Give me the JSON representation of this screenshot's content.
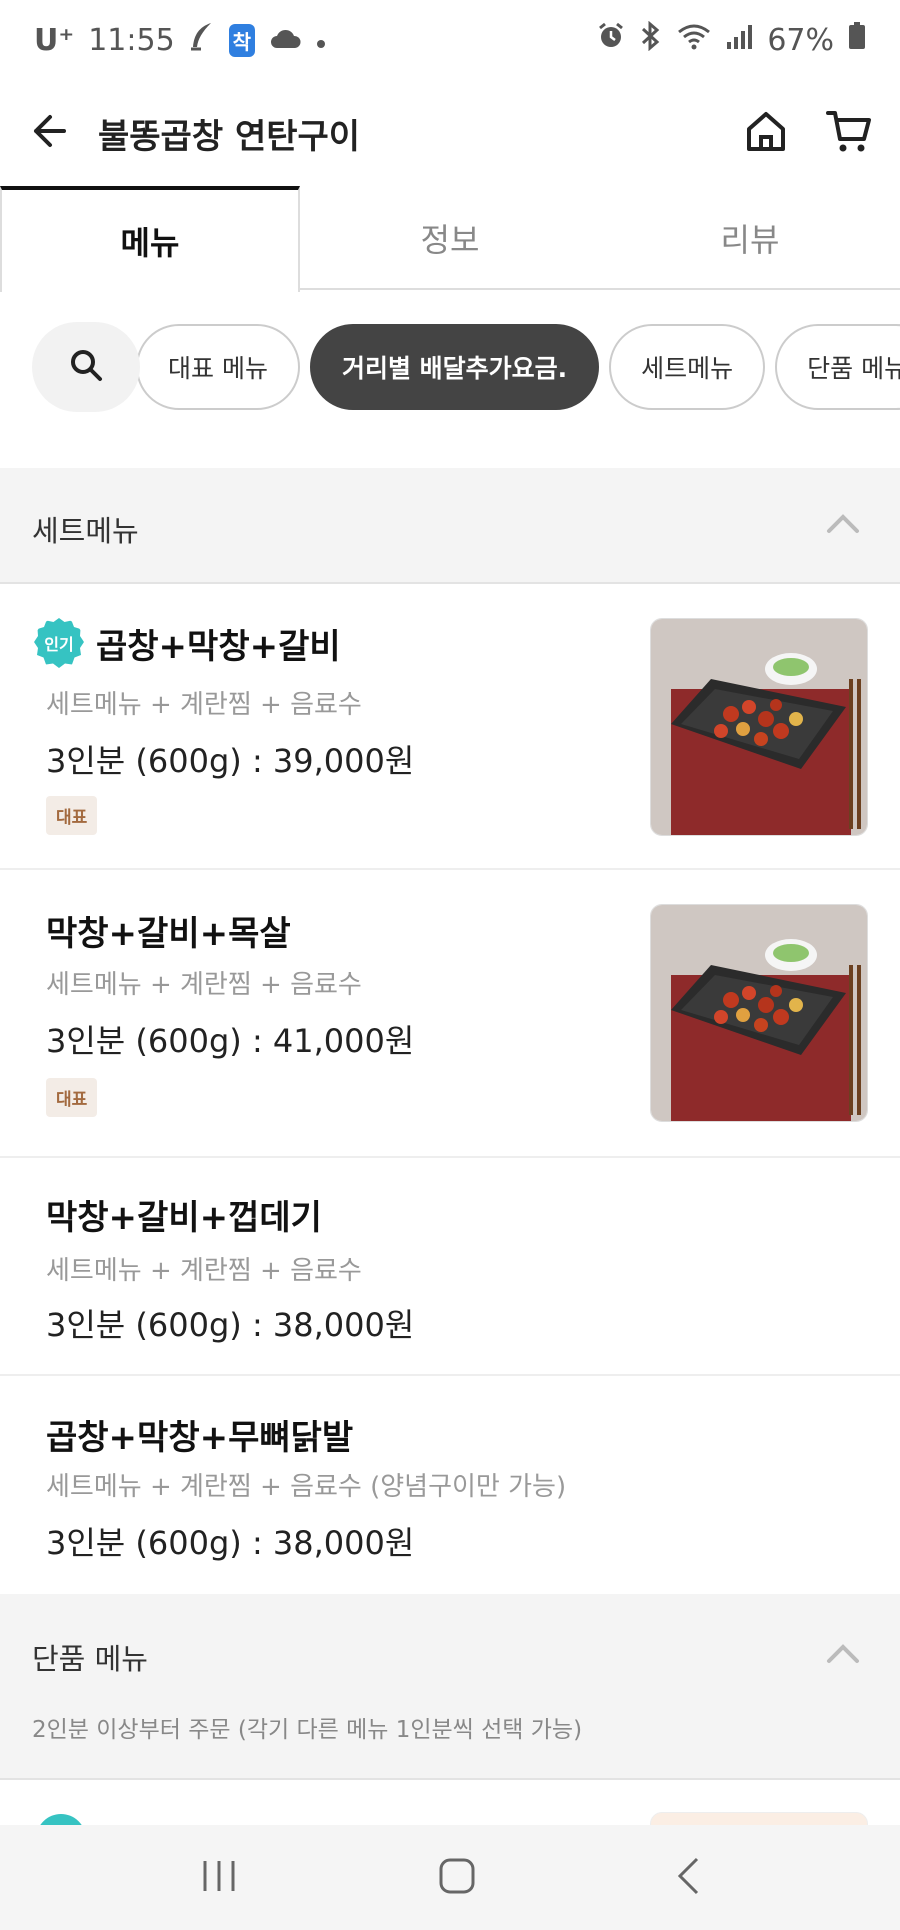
{
  "status": {
    "carrier": "U⁺",
    "time": "11:55",
    "chak": "착",
    "battery": "67%"
  },
  "header": {
    "title": "불똥곱창 연탄구이"
  },
  "tabs": [
    {
      "label": "메뉴"
    },
    {
      "label": "정보"
    },
    {
      "label": "리뷰"
    }
  ],
  "chips": [
    {
      "label": "대표 메뉴"
    },
    {
      "label": "거리별 배달추가요금."
    },
    {
      "label": "세트메뉴"
    },
    {
      "label": "단품 메뉴"
    }
  ],
  "sections": {
    "set": {
      "name": "세트메뉴"
    },
    "single": {
      "name": "단품 메뉴",
      "desc": "2인분 이상부터 주문 (각기 다른 메뉴 1인분씩 선택 가능)"
    }
  },
  "items": [
    {
      "badge_popular": "인기",
      "name": "곱창+막창+갈비",
      "sub": "세트메뉴 + 계란찜 + 음료수",
      "price": "3인분 (600g) : 39,000원",
      "tag": "대표"
    },
    {
      "name": "막창+갈비+목살",
      "sub": "세트메뉴 + 계란찜 + 음료수",
      "price": "3인분 (600g) : 41,000원",
      "tag": "대표"
    },
    {
      "name": "막창+갈비+껍데기",
      "sub": "세트메뉴 + 계란찜 + 음료수",
      "price": "3인분 (600g) : 38,000원"
    },
    {
      "name": "곱창+막창+무뼈닭발",
      "sub": "세트메뉴 + 계란찜 + 음료수 (양념구이만 가능)",
      "price": "3인분 (600g) : 38,000원"
    }
  ],
  "colors": {
    "accent_popular": "#36c3c2",
    "chip_active": "#444444",
    "tag_bg": "#f3ece6",
    "tag_text": "#a36a3f"
  }
}
